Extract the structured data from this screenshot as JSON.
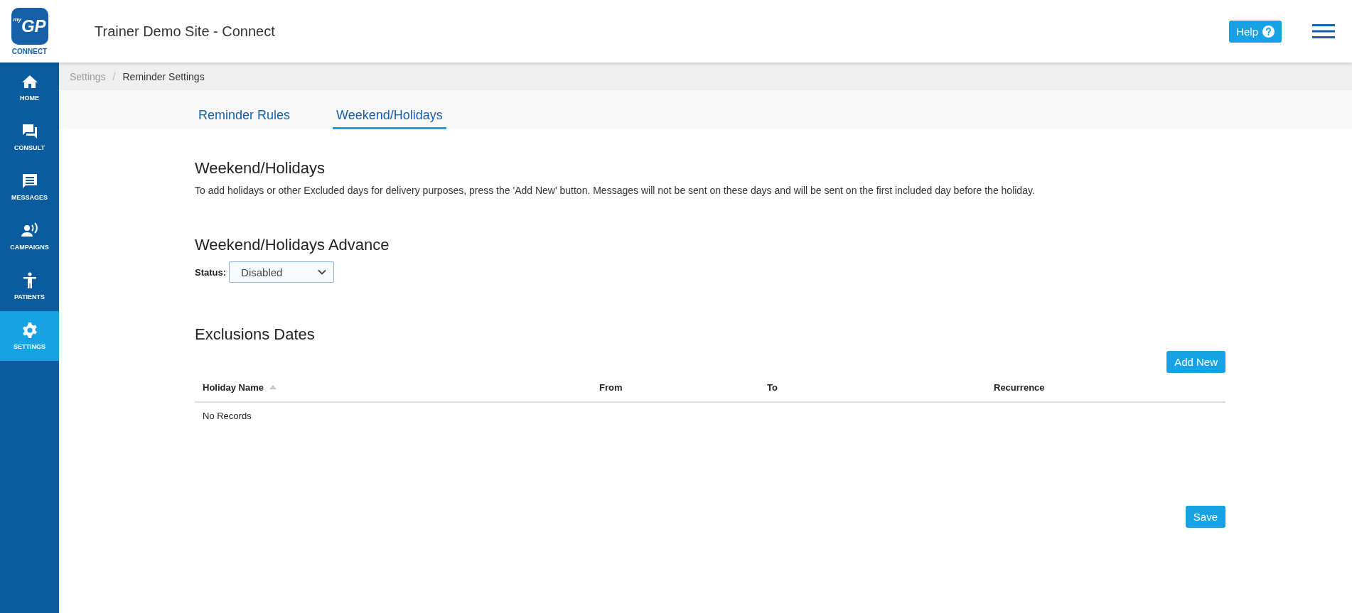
{
  "header": {
    "logo_badge": "GP",
    "logo_badge_prefix": "my",
    "logo_caption": "CONNECT",
    "title": "Trainer Demo Site - Connect",
    "help_button": "Help"
  },
  "sidebar": {
    "items": [
      {
        "kind": "home",
        "label": "HOME",
        "selected": false
      },
      {
        "kind": "consult",
        "label": "CONSULT",
        "selected": false
      },
      {
        "kind": "messages",
        "label": "MESSAGES",
        "selected": false
      },
      {
        "kind": "campaigns",
        "label": "CAMPAIGNS",
        "selected": false
      },
      {
        "kind": "patients",
        "label": "PATIENTS",
        "selected": false
      },
      {
        "kind": "settings",
        "label": "SETTINGS",
        "selected": true
      }
    ]
  },
  "breadcrumb": {
    "items": [
      "Settings",
      "Reminder Settings"
    ],
    "separator": "/"
  },
  "tabs": [
    {
      "label": "Reminder Rules",
      "selected": false
    },
    {
      "label": "Weekend/Holidays",
      "selected": true
    }
  ],
  "section": {
    "title": "Weekend/Holidays",
    "description": "To add holidays or other Excluded days for delivery purposes, press the 'Add New' button. Messages will not be sent on these days and will be sent on the first included day before the holiday."
  },
  "advance": {
    "title": "Weekend/Holidays Advance",
    "status_label": "Status:",
    "status_value": "Disabled"
  },
  "exclusions": {
    "title": "Exclusions Dates",
    "add_button": "Add New",
    "table": {
      "columns": [
        {
          "label": "Holiday Name",
          "sorted": true
        },
        {
          "label": "From",
          "sorted": false
        },
        {
          "label": "To",
          "sorted": false
        },
        {
          "label": "Recurrence",
          "sorted": false
        }
      ],
      "empty_text": "No Records"
    }
  },
  "save_button": "Save"
}
